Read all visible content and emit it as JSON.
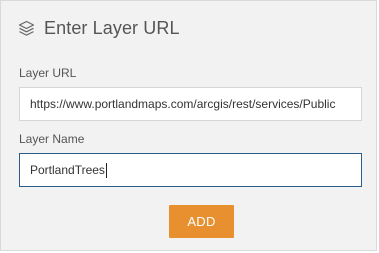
{
  "dialog": {
    "title": "Enter Layer URL",
    "icon": "layers-icon"
  },
  "fields": {
    "url": {
      "label": "Layer URL",
      "value": "https://www.portlandmaps.com/arcgis/rest/services/Public"
    },
    "name": {
      "label": "Layer Name",
      "value": "PortlandTrees"
    }
  },
  "actions": {
    "add_label": "ADD"
  },
  "colors": {
    "panel_bg": "#f2f2f2",
    "accent_button": "#e8902f",
    "focus_border": "#2c5d8a",
    "text": "#555555"
  }
}
